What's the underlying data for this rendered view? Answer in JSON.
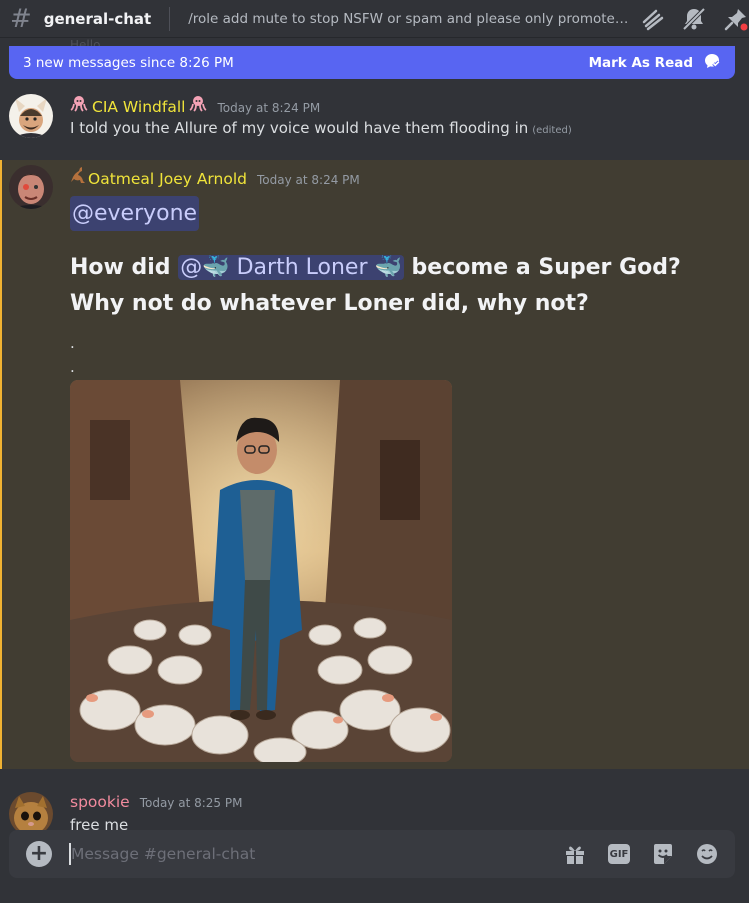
{
  "header": {
    "channel_icon": "hash-icon",
    "channel_name": "general-chat",
    "topic": "/role add mute to stop NSFW or spam and please only promote the...",
    "icons": [
      "threads-icon",
      "notifications-muted-icon",
      "pinned-icon"
    ]
  },
  "ghost_partial_text": "Hello",
  "new_messages_bar": {
    "text": "3 new messages since 8:26 PM",
    "action_label": "Mark As Read",
    "icon": "mark-read-icon"
  },
  "messages": [
    {
      "author": "CIA Windfall",
      "author_color": "#f0e43a",
      "badge_icon": "octopus-icon",
      "timestamp": "Today at 8:24 PM",
      "text": "I told you the Allure of my voice would have them flooding in",
      "edited_label": "(edited)"
    },
    {
      "author": "Oatmeal Joey Arnold",
      "author_color": "#f0e43a",
      "badge_icon": "kangaroo-icon",
      "timestamp": "Today at 8:24 PM",
      "mention_everyone": "@everyone",
      "question_prefix": "How did",
      "mention_user": "@🐳 Darth Loner 🐳",
      "question_suffix": "become a Super God? Why not do whatever Loner did, why not?",
      "dots": [
        ".",
        "."
      ],
      "attachment": "image-attachment",
      "highlight_color": "#f0b232"
    },
    {
      "author": "spookie",
      "author_color": "#f28b9e",
      "timestamp": "Today at 8:25 PM",
      "text": "free me"
    }
  ],
  "composer": {
    "placeholder": "Message #general-chat",
    "icons": [
      "add-attachment-icon",
      "gift-icon",
      "gif-icon",
      "sticker-icon",
      "emoji-icon"
    ],
    "gif_label": "GIF"
  }
}
